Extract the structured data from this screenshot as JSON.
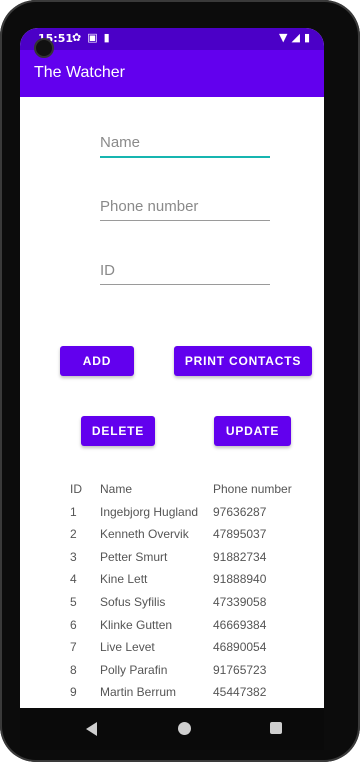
{
  "status_bar": {
    "time": "15:51",
    "left_icons": [
      "gear-icon",
      "a-icon",
      "sd-card-icon"
    ],
    "right_icons": [
      "wifi-icon",
      "signal-icon",
      "battery-icon"
    ]
  },
  "app_bar": {
    "title": "The Watcher"
  },
  "form": {
    "name": {
      "placeholder": "Name",
      "value": ""
    },
    "phone": {
      "placeholder": "Phone number",
      "value": ""
    },
    "id": {
      "placeholder": "ID",
      "value": ""
    }
  },
  "buttons": {
    "add": "ADD",
    "print_contacts": "PRINT CONTACTS",
    "delete": "DELETE",
    "update": "UPDATE"
  },
  "accent_colors": {
    "primary": "#6200ee",
    "status_bar": "#4b00c7",
    "focus_underline": "#16b5b0"
  },
  "table": {
    "headers": [
      "ID",
      "Name",
      "Phone number"
    ],
    "rows": [
      [
        "1",
        "Ingebjorg Hugland",
        "97636287"
      ],
      [
        "2",
        "Kenneth Overvik",
        "47895037"
      ],
      [
        "3",
        "Petter Smurt",
        "91882734"
      ],
      [
        "4",
        "Kine Lett",
        "91888940"
      ],
      [
        "5",
        "Sofus Syfilis",
        "47339058"
      ],
      [
        "6",
        "Klinke Gutten",
        "46669384"
      ],
      [
        "7",
        "Live Levet",
        "46890054"
      ],
      [
        "8",
        "Polly Parafin",
        "91765723"
      ],
      [
        "9",
        "Martin Berrum",
        "45447382"
      ]
    ]
  }
}
